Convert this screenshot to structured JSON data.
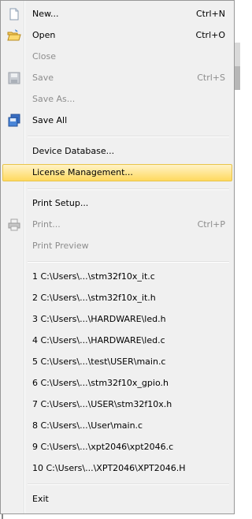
{
  "menu": {
    "items": [
      {
        "label": "New...",
        "shortcut": "Ctrl+N",
        "icon": "new-file-icon",
        "disabled": false
      },
      {
        "label": "Open",
        "shortcut": "Ctrl+O",
        "icon": "open-folder-icon",
        "disabled": false
      },
      {
        "label": "Close",
        "shortcut": "",
        "icon": "",
        "disabled": true
      },
      {
        "label": "Save",
        "shortcut": "Ctrl+S",
        "icon": "save-icon",
        "disabled": true
      },
      {
        "label": "Save As...",
        "shortcut": "",
        "icon": "",
        "disabled": true
      },
      {
        "label": "Save All",
        "shortcut": "",
        "icon": "save-all-icon",
        "disabled": false
      },
      {
        "label": "Device Database...",
        "shortcut": "",
        "icon": "",
        "disabled": false
      },
      {
        "label": "License Management...",
        "shortcut": "",
        "icon": "",
        "disabled": false,
        "highlighted": true
      },
      {
        "label": "Print Setup...",
        "shortcut": "",
        "icon": "",
        "disabled": false
      },
      {
        "label": "Print...",
        "shortcut": "Ctrl+P",
        "icon": "printer-icon",
        "disabled": true
      },
      {
        "label": "Print Preview",
        "shortcut": "",
        "icon": "",
        "disabled": true
      },
      {
        "label": "1 C:\\Users\\...\\stm32f10x_it.c",
        "shortcut": "",
        "icon": "",
        "disabled": false
      },
      {
        "label": "2 C:\\Users\\...\\stm32f10x_it.h",
        "shortcut": "",
        "icon": "",
        "disabled": false
      },
      {
        "label": "3 C:\\Users\\...\\HARDWARE\\led.h",
        "shortcut": "",
        "icon": "",
        "disabled": false
      },
      {
        "label": "4 C:\\Users\\...\\HARDWARE\\led.c",
        "shortcut": "",
        "icon": "",
        "disabled": false
      },
      {
        "label": "5 C:\\Users\\...\\test\\USER\\main.c",
        "shortcut": "",
        "icon": "",
        "disabled": false
      },
      {
        "label": "6 C:\\Users\\...\\stm32f10x_gpio.h",
        "shortcut": "",
        "icon": "",
        "disabled": false
      },
      {
        "label": "7 C:\\Users\\...\\USER\\stm32f10x.h",
        "shortcut": "",
        "icon": "",
        "disabled": false
      },
      {
        "label": "8 C:\\Users\\...\\User\\main.c",
        "shortcut": "",
        "icon": "",
        "disabled": false
      },
      {
        "label": "9 C:\\Users\\...\\xpt2046\\xpt2046.c",
        "shortcut": "",
        "icon": "",
        "disabled": false
      },
      {
        "label": "10 C:\\Users\\...\\XPT2046\\XPT2046.H",
        "shortcut": "",
        "icon": "",
        "disabled": false
      },
      {
        "label": "Exit",
        "shortcut": "",
        "icon": "",
        "disabled": false
      }
    ]
  },
  "colors": {
    "highlight_top": "#fff3c7",
    "highlight_bottom": "#ffd95f",
    "disabled_text": "#8d8d8d",
    "menu_bg": "#f0f0f0"
  }
}
